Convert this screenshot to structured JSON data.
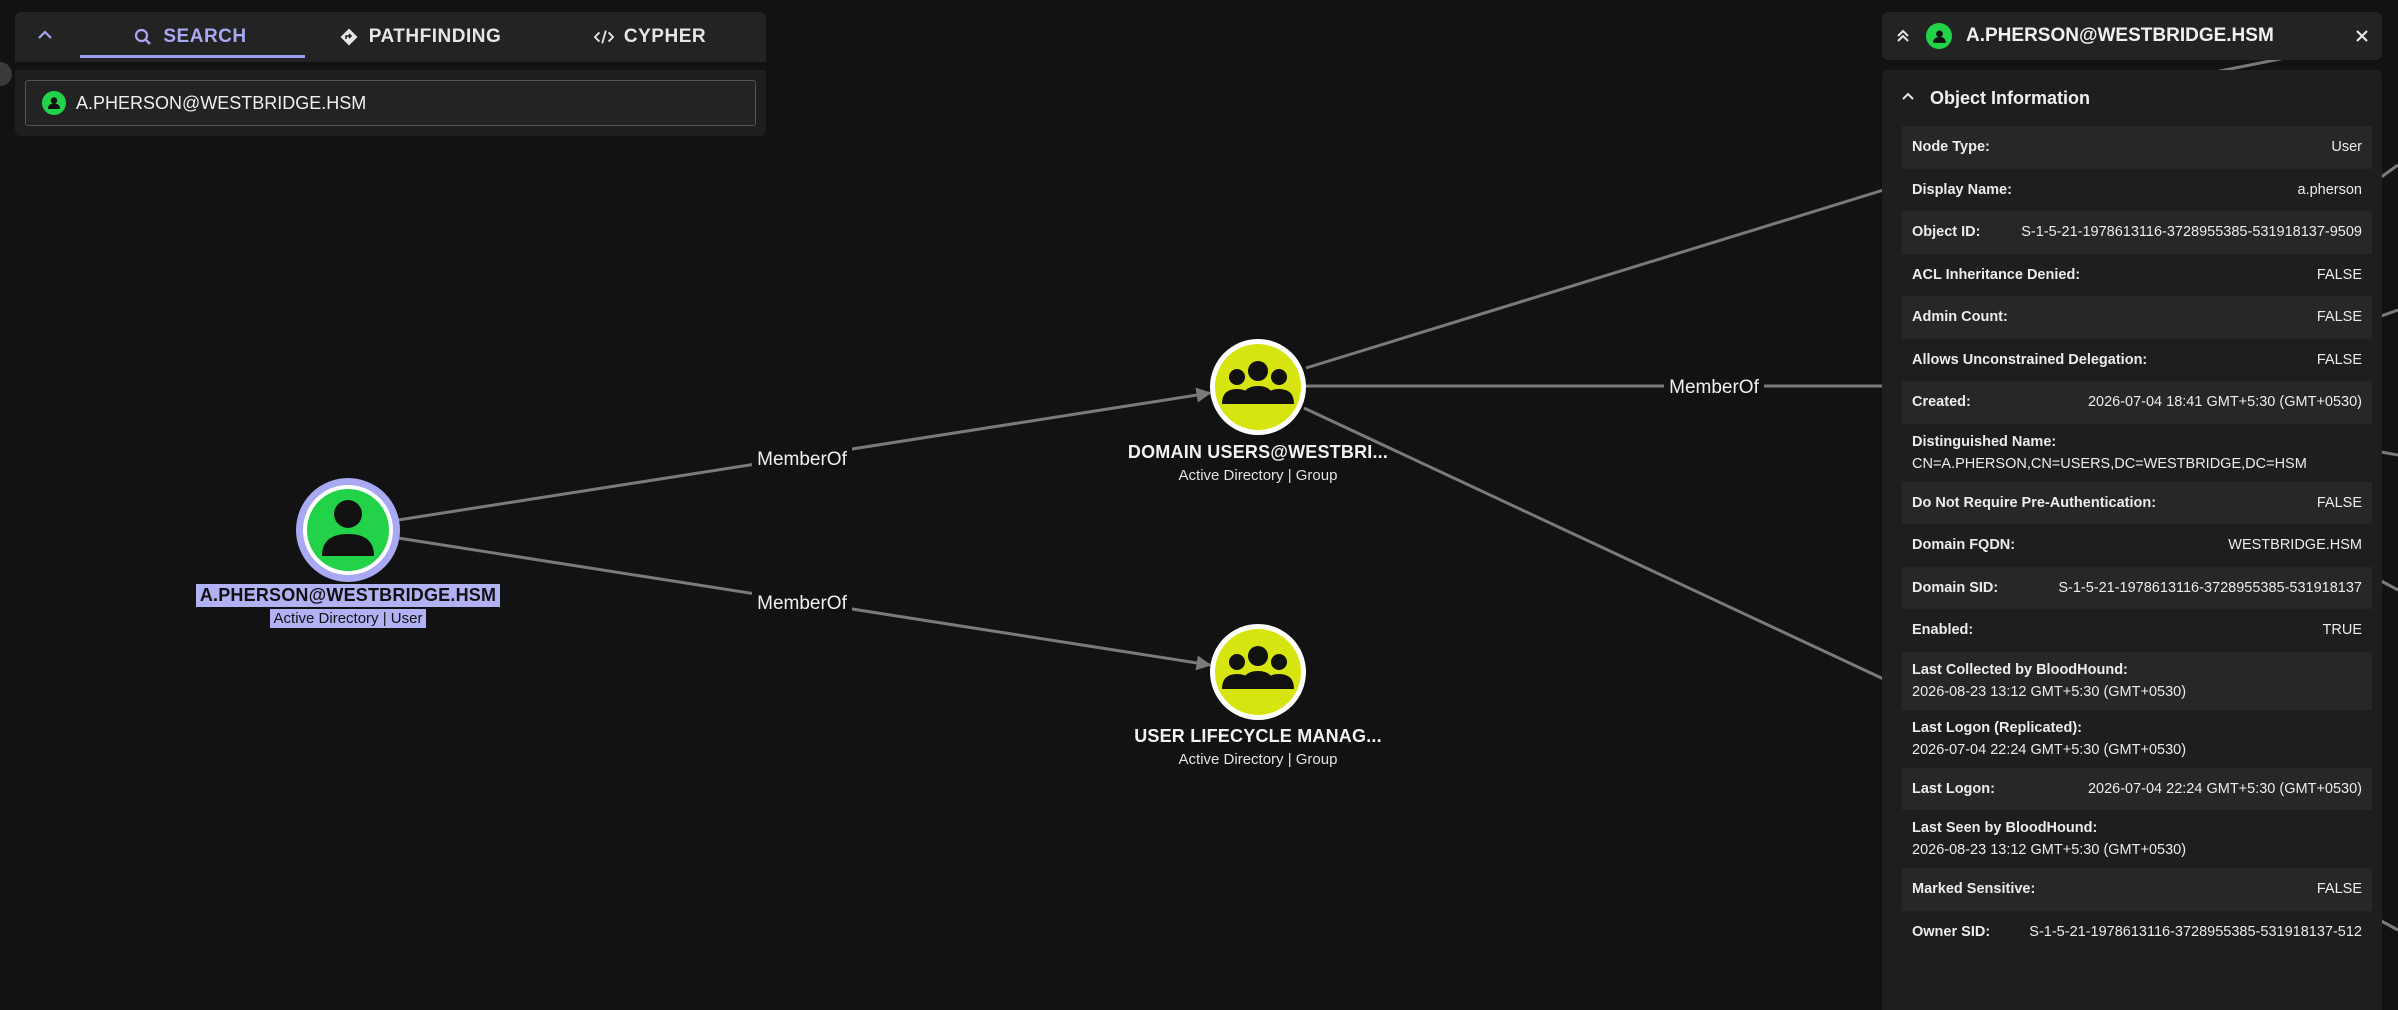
{
  "colors": {
    "accent": "#9a9ef2",
    "user_node": "#22d34a",
    "group_node": "#d6e50f",
    "background": "#121212"
  },
  "search_panel": {
    "collapse_icon": "chevron-up-icon",
    "tabs": [
      {
        "label": "SEARCH",
        "icon": "magnifier-icon",
        "active": true
      },
      {
        "label": "PATHFINDING",
        "icon": "route-diamond-icon",
        "active": false
      },
      {
        "label": "CYPHER",
        "icon": "code-icon",
        "active": false
      }
    ],
    "search_value": "A.PHERSON@WESTBRIDGE.HSM"
  },
  "graph": {
    "nodes": {
      "user": {
        "title": "A.PHERSON@WESTBRIDGE.HSM",
        "subtitle": "Active Directory | User",
        "icon": "user-icon"
      },
      "domain_users": {
        "title": "DOMAIN USERS@WESTBRI...",
        "subtitle": "Active Directory | Group",
        "icon": "group-icon"
      },
      "lifecycle": {
        "title": "USER LIFECYCLE MANAG...",
        "subtitle": "Active Directory | Group",
        "icon": "group-icon"
      }
    },
    "edges": [
      {
        "label": "MemberOf"
      },
      {
        "label": "MemberOf"
      },
      {
        "label": "MemberOf"
      }
    ]
  },
  "side_panel": {
    "title": "A.PHERSON@WESTBRIDGE.HSM",
    "section_title": "Object Information",
    "properties": [
      {
        "k": "Node Type:",
        "v": "User"
      },
      {
        "k": "Display Name:",
        "v": "a.pherson"
      },
      {
        "k": "Object ID:",
        "v": "S-1-5-21-1978613116-3728955385-531918137-9509"
      },
      {
        "k": "ACL Inheritance Denied:",
        "v": "FALSE"
      },
      {
        "k": "Admin Count:",
        "v": "FALSE"
      },
      {
        "k": "Allows Unconstrained Delegation:",
        "v": "FALSE"
      },
      {
        "k": "Created:",
        "v": "2026-07-04 18:41 GMT+5:30 (GMT+0530)"
      },
      {
        "k": "Distinguished Name:",
        "v": "CN=A.PHERSON,CN=USERS,DC=WESTBRIDGE,DC=HSM"
      },
      {
        "k": "Do Not Require Pre-Authentication:",
        "v": "FALSE"
      },
      {
        "k": "Domain FQDN:",
        "v": "WESTBRIDGE.HSM"
      },
      {
        "k": "Domain SID:",
        "v": "S-1-5-21-1978613116-3728955385-531918137"
      },
      {
        "k": "Enabled:",
        "v": "TRUE"
      },
      {
        "k": "Last Collected by BloodHound:",
        "v": "2026-08-23 13:12 GMT+5:30 (GMT+0530)"
      },
      {
        "k": "Last Logon (Replicated):",
        "v": "2026-07-04 22:24 GMT+5:30 (GMT+0530)"
      },
      {
        "k": "Last Logon:",
        "v": "2026-07-04 22:24 GMT+5:30 (GMT+0530)"
      },
      {
        "k": "Last Seen by BloodHound:",
        "v": "2026-08-23 13:12 GMT+5:30 (GMT+0530)"
      },
      {
        "k": "Marked Sensitive:",
        "v": "FALSE"
      },
      {
        "k": "Owner SID:",
        "v": "S-1-5-21-1978613116-3728955385-531918137-512"
      }
    ]
  }
}
